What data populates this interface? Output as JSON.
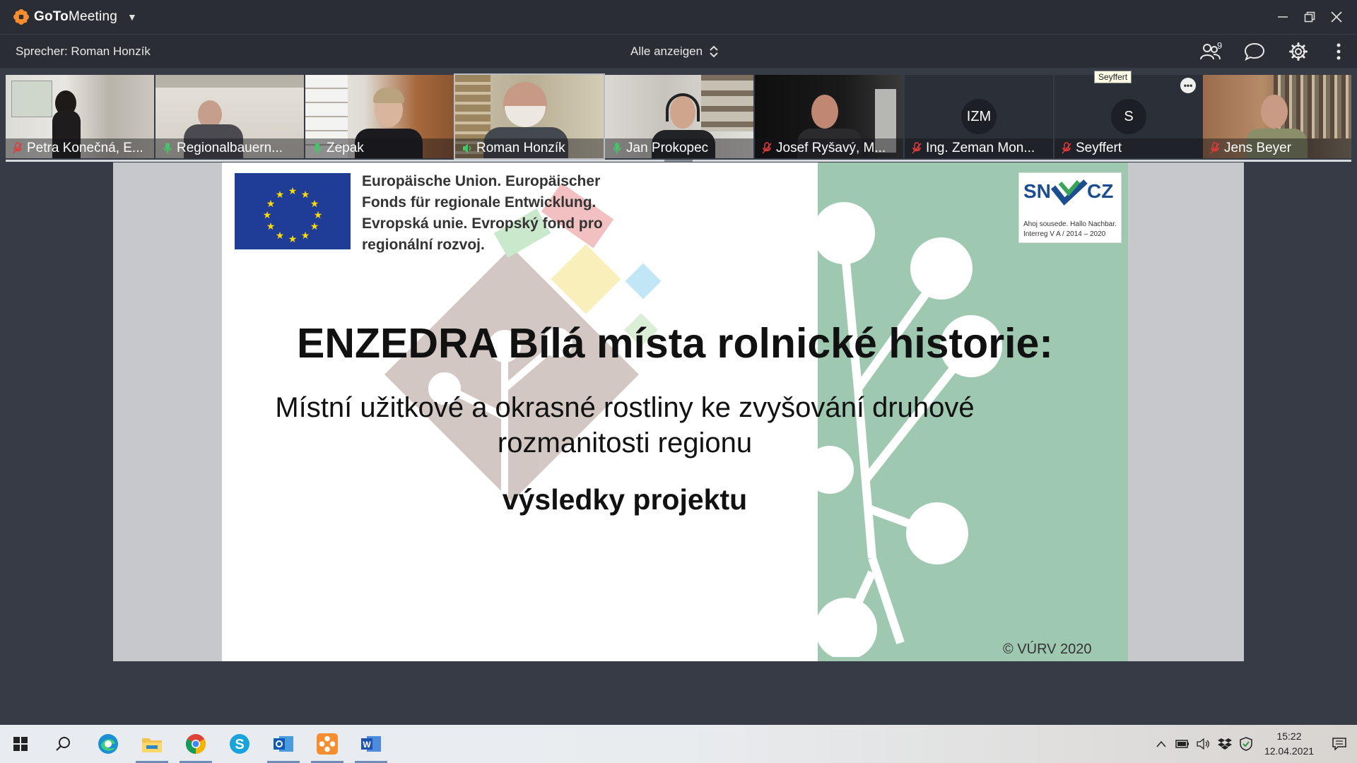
{
  "app": {
    "name_bold": "GoTo",
    "name_light": "Meeting",
    "accent_color": "#f68d2e"
  },
  "toolbar": {
    "speaker": "Sprecher: Roman Honzík",
    "view_all": "Alle anzeigen",
    "participant_count": "9"
  },
  "participants": [
    {
      "name": "Petra Konečná, E...",
      "mic": "muted",
      "video": true
    },
    {
      "name": "Regionalbauern...",
      "mic": "on",
      "video": true
    },
    {
      "name": "Zepak",
      "mic": "on",
      "video": true
    },
    {
      "name": "Roman Honzík",
      "mic": "speaking",
      "video": true,
      "active": true
    },
    {
      "name": "Jan Prokopec",
      "mic": "on",
      "video": true
    },
    {
      "name": "Josef Ryšavý, M...",
      "mic": "muted",
      "video": true
    },
    {
      "name": "Ing. Zeman Mon...",
      "mic": "muted",
      "video": false,
      "initials": "IZM"
    },
    {
      "name": "Seyffert",
      "mic": "muted",
      "video": false,
      "initials": "S"
    },
    {
      "name": "Jens Beyer",
      "mic": "muted",
      "video": true
    }
  ],
  "tooltip": "Seyffert",
  "slide": {
    "eu_text": [
      "Europäische Union. Europäischer",
      "Fonds für regionale Entwicklung.",
      "Evropská unie. Evropský fond pro",
      "regionální rozvoj."
    ],
    "logo_left": "SN",
    "logo_right": "CZ",
    "logo_sub1": "Ahoj sousede. Hallo Nachbar.",
    "logo_sub2": "Interreg V A / 2014 – 2020",
    "title": "ENZEDRA Bílá místa rolnické historie:",
    "subtitle_line1": "Místní užitkové a okrasné rostliny ke zvyšování druhové",
    "subtitle_line2": "rozmanitosti regionu",
    "subtitle2": "výsledky projektu",
    "copyright": "© VÚRV 2020"
  },
  "taskbar": {
    "apps": [
      "windows-start",
      "search",
      "edge",
      "file-explorer",
      "chrome",
      "skype",
      "outlook",
      "gotomeeting",
      "word"
    ],
    "time": "15:22",
    "date": "12.04.2021"
  }
}
